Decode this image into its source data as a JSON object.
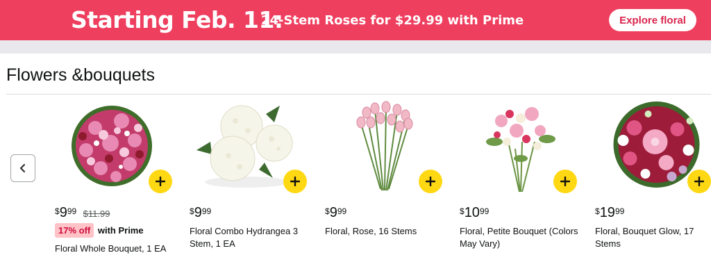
{
  "banner": {
    "headline": "Starting Feb. 11:",
    "subline": "24-Stem Roses for $29.99 with Prime",
    "cta_label": "Explore floral",
    "bg_color": "#ef3f5f"
  },
  "section": {
    "title": "Flowers &bouquets"
  },
  "carousel": {
    "prev_icon": "chevron-left-icon",
    "add_icon": "plus-icon"
  },
  "products": [
    {
      "price_symbol": "$",
      "price_whole": "9",
      "price_fraction": "99",
      "list_price": "$11.99",
      "deal_badge": "17% off",
      "deal_text": "with Prime",
      "title": "Floral Whole Bouquet, 1 EA"
    },
    {
      "price_symbol": "$",
      "price_whole": "9",
      "price_fraction": "99",
      "title": "Floral Combo Hydrangea 3 Stem, 1 EA"
    },
    {
      "price_symbol": "$",
      "price_whole": "9",
      "price_fraction": "99",
      "title": "Floral, Rose, 16 Stems"
    },
    {
      "price_symbol": "$",
      "price_whole": "10",
      "price_fraction": "99",
      "title": "Floral, Petite Bouquet (Colors May Vary)"
    },
    {
      "price_symbol": "$",
      "price_whole": "19",
      "price_fraction": "99",
      "title": "Floral, Bouquet Glow, 17 Stems"
    }
  ]
}
